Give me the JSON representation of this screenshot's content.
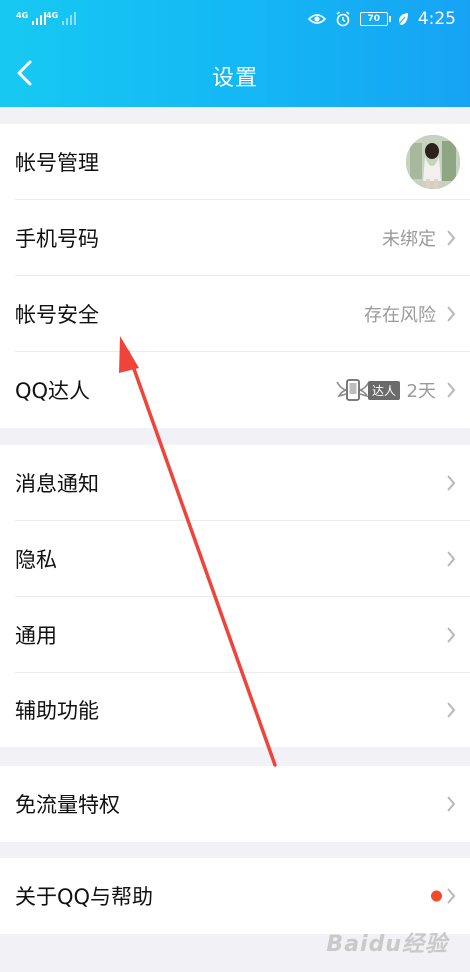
{
  "status_bar": {
    "network1": "4G",
    "network2": "4G",
    "battery": "70",
    "time": "4:25"
  },
  "header": {
    "title": "设置",
    "back_icon": "chevron-left-icon"
  },
  "groups": [
    {
      "items": [
        {
          "label": "帐号管理",
          "accessory": "avatar"
        },
        {
          "label": "手机号码",
          "value": "未绑定"
        },
        {
          "label": "帐号安全",
          "value": "存在风险"
        },
        {
          "label": "QQ达人",
          "badge": "达人",
          "value": "2天"
        }
      ]
    },
    {
      "items": [
        {
          "label": "消息通知"
        },
        {
          "label": "隐私"
        },
        {
          "label": "通用"
        },
        {
          "label": "辅助功能"
        }
      ]
    },
    {
      "items": [
        {
          "label": "免流量特权"
        }
      ]
    },
    {
      "items": [
        {
          "label": "关于QQ与帮助",
          "dot_color": "#f04b2c"
        }
      ]
    }
  ],
  "colors": {
    "header_start": "#16c9f2",
    "header_end": "#16a3f4",
    "arrow": "#f0443a",
    "red_dot": "#f04b2c"
  },
  "watermark": "Baidu经验"
}
